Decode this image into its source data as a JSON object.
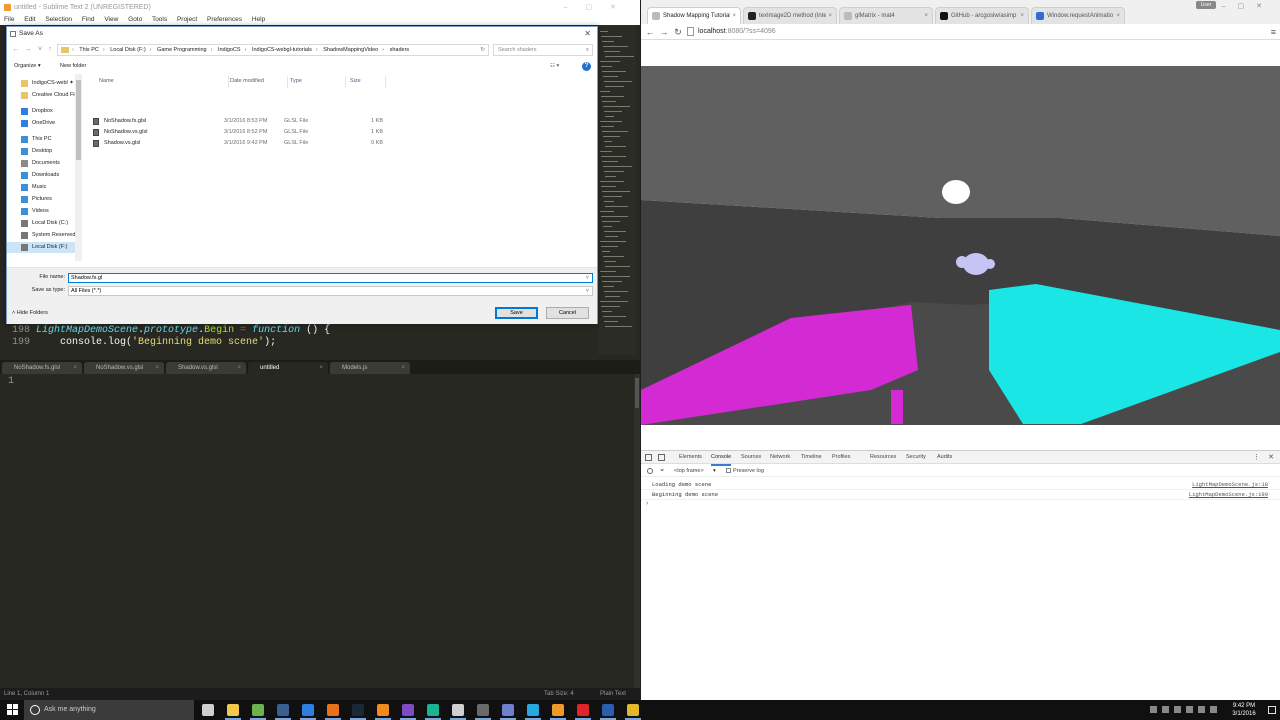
{
  "sublime": {
    "title": "untitled - Sublime Text 2 (UNREGISTERED)",
    "menu": [
      "File",
      "Edit",
      "Selection",
      "Find",
      "View",
      "Goto",
      "Tools",
      "Project",
      "Preferences",
      "Help"
    ],
    "code_lines": [
      {
        "num": "198",
        "obj": "LightMapDemoScene",
        "dot1": ".",
        "proto": "prototype",
        "dot2": ".",
        "method": "Begin",
        "eq": " = ",
        "func": "function",
        "rest": " () {"
      },
      {
        "num": "199",
        "indent": "    ",
        "call": "console.log(",
        "str": "'Beginning demo scene'",
        "end": ");"
      }
    ],
    "tabs": [
      {
        "label": "NoShadow.fs.glsl",
        "close": "×"
      },
      {
        "label": "NoShadow.vs.glsl",
        "close": "×"
      },
      {
        "label": "Shadow.vs.glsl",
        "close": "×"
      },
      {
        "label": "untitled",
        "close": "×"
      },
      {
        "label": "Models.js",
        "close": "×"
      }
    ],
    "active_tab_index": 3,
    "editor_line_number": "1",
    "status": {
      "position": "Line 1, Column 1",
      "tab_size": "Tab Size: 4",
      "syntax": "Plain Text"
    }
  },
  "save_dialog": {
    "title": "Save As",
    "close": "✕",
    "path": [
      "This PC",
      "Local Disk (F:)",
      "Game Programming",
      "IndigoCS",
      "IndigoCS-webgl-tutorials",
      "ShadowMappingVideo",
      "shaders"
    ],
    "path_sep": "›",
    "search_placeholder": "Search shaders",
    "toolbar": {
      "organize": "Organize ▾",
      "new_folder": "New folder",
      "view": "☷ ▾",
      "help": "?"
    },
    "nav_items": [
      {
        "label": "IndigoCS-webl ✦",
        "icon_color": "#e8c46a"
      },
      {
        "label": "Creative Cloud Fil",
        "icon_color": "#e8c46a"
      },
      {
        "label": "Dropbox",
        "icon_color": "#2e7fe0"
      },
      {
        "label": "OneDrive",
        "icon_color": "#2e7fe0"
      },
      {
        "label": "This PC",
        "icon_color": "#3a8fd8"
      },
      {
        "label": "Desktop",
        "icon_color": "#3a8fd8"
      },
      {
        "label": "Documents",
        "icon_color": "#8a8a8a"
      },
      {
        "label": "Downloads",
        "icon_color": "#3a8fd8"
      },
      {
        "label": "Music",
        "icon_color": "#3a8fd8"
      },
      {
        "label": "Pictures",
        "icon_color": "#3a8fd8"
      },
      {
        "label": "Videos",
        "icon_color": "#3a8fd8"
      },
      {
        "label": "Local Disk (C:)",
        "icon_color": "#777777"
      },
      {
        "label": "System Reserved",
        "icon_color": "#777777"
      },
      {
        "label": "Local Disk (F:)",
        "icon_color": "#777777"
      }
    ],
    "selected_nav_index": 13,
    "columns": {
      "name": "Name",
      "date": "Date modified",
      "type": "Type",
      "size": "Size"
    },
    "files": [
      {
        "name": "NoShadow.fs.glsl",
        "date": "3/1/2016 8:53 PM",
        "type": "GLSL File",
        "size": "1 KB"
      },
      {
        "name": "NoShadow.vs.glsl",
        "date": "3/1/2016 8:52 PM",
        "type": "GLSL File",
        "size": "1 KB"
      },
      {
        "name": "Shadow.vs.glsl",
        "date": "3/1/2016 9:42 PM",
        "type": "GLSL File",
        "size": "0 KB"
      }
    ],
    "file_name_label": "File name:",
    "file_name_value": "Shadow.fs.gl",
    "save_type_label": "Save as type:",
    "save_type_value": "All Files (*.*)",
    "hide_folders": "Hide Folders",
    "save_button": "Save",
    "cancel_button": "Cancel"
  },
  "chrome": {
    "tabs": [
      {
        "label": "Shadow Mapping Tutorial",
        "favicon_color": "#bbbbbb"
      },
      {
        "label": "texImage2D method (Inte",
        "favicon_color": "#222222"
      },
      {
        "label": "glMatrix - mat4",
        "favicon_color": "#bbbbbb"
      },
      {
        "label": "GitHub - arcgoslw/asimp",
        "favicon_color": "#111111"
      },
      {
        "label": "Window.requestAnimatio",
        "favicon_color": "#2a6fd6"
      }
    ],
    "tab_close": "×",
    "active_tab_index": 0,
    "user_badge": "User",
    "url_host": "localhost",
    "url_rest": ":8080/?ss=4096",
    "devtools": {
      "tabs": [
        "Elements",
        "Console",
        "Sources",
        "Network",
        "Timeline",
        "Profiles",
        "Resources",
        "Security",
        "Audits"
      ],
      "active_tab_index": 1,
      "context": "<top frame>",
      "preserve_log": "Preserve log",
      "logs": [
        {
          "text": "Loading demo scene",
          "source": "LightMapDemoScene.js:18"
        },
        {
          "text": "Beginning demo scene",
          "source": "LightMapDemoScene.js:199"
        }
      ],
      "prompt": "›"
    }
  },
  "scene_colors": {
    "sky": "#ffffff",
    "ceiling": "#606060",
    "wall": "#3f3f3f",
    "floor": "#4a4a4a",
    "magenta": "#d42ad4",
    "cyan": "#1ae6e6",
    "lamp": "#ffffff",
    "monkey": "#c5c5f5"
  },
  "taskbar": {
    "search_placeholder": "Ask me anything",
    "apps": [
      {
        "name": "task-view-icon",
        "color": "#cfcfcf"
      },
      {
        "name": "file-explorer-icon",
        "color": "#f2c94c"
      },
      {
        "name": "green-app-icon",
        "color": "#6bb34a"
      },
      {
        "name": "sublime-text-icon",
        "color": "#3b5f8f"
      },
      {
        "name": "edge-icon",
        "color": "#2e7fe0"
      },
      {
        "name": "firefox-icon",
        "color": "#e8711c"
      },
      {
        "name": "steam-icon",
        "color": "#1b2838"
      },
      {
        "name": "blender-icon",
        "color": "#f28b1e"
      },
      {
        "name": "visual-studio-icon",
        "color": "#7e4bc5"
      },
      {
        "name": "gitkraken-icon",
        "color": "#1ab394"
      },
      {
        "name": "unity-icon",
        "color": "#cfcfcf"
      },
      {
        "name": "terminal-icon",
        "color": "#6a6a6a"
      },
      {
        "name": "chromium-icon",
        "color": "#6f7fd0"
      },
      {
        "name": "skype-icon",
        "color": "#29a8e0"
      },
      {
        "name": "fl-studio-icon",
        "color": "#f09a2a"
      },
      {
        "name": "heart-app-icon",
        "color": "#e0242a"
      },
      {
        "name": "powershell-icon",
        "color": "#2a5fb0"
      },
      {
        "name": "chrome-icon",
        "color": "#e0b82a"
      }
    ],
    "time": "9:42 PM",
    "date": "3/1/2016"
  }
}
